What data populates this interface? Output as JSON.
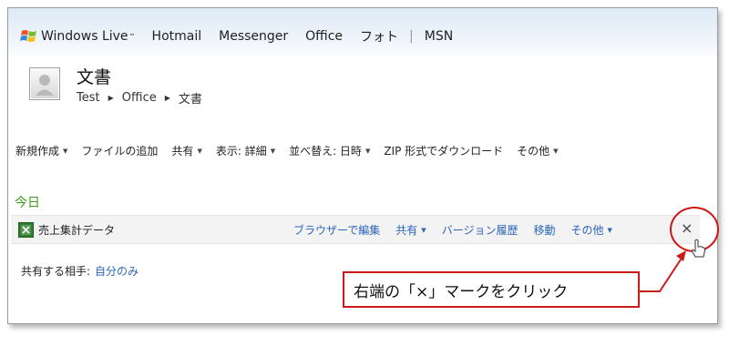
{
  "nav": {
    "brand": "Windows Live",
    "brand_tm": "™",
    "links": [
      "Hotmail",
      "Messenger",
      "Office",
      "フォト"
    ],
    "separator": "|",
    "last_link": "MSN"
  },
  "folder": {
    "title": "文書",
    "breadcrumb": [
      "Test",
      "Office",
      "文書"
    ]
  },
  "toolbar": {
    "items": [
      {
        "label": "新規作成",
        "dropdown": true
      },
      {
        "label": "ファイルの追加",
        "dropdown": false
      },
      {
        "label": "共有",
        "dropdown": true
      },
      {
        "label": "表示: 詳細",
        "dropdown": true
      },
      {
        "label": "並べ替え: 日時",
        "dropdown": true
      },
      {
        "label": "ZIP 形式でダウンロード",
        "dropdown": false
      },
      {
        "label": "その他",
        "dropdown": true
      }
    ]
  },
  "section_label": "今日",
  "file": {
    "icon": "excel-file-icon",
    "name": "売上集計データ",
    "actions": [
      {
        "label": "ブラウザーで編集",
        "dropdown": false
      },
      {
        "label": "共有",
        "dropdown": true
      },
      {
        "label": "バージョン履歴",
        "dropdown": false
      },
      {
        "label": "移動",
        "dropdown": false
      },
      {
        "label": "その他",
        "dropdown": true
      }
    ],
    "delete_glyph": "×"
  },
  "sharing": {
    "label": "共有する相手:",
    "value": "自分のみ"
  },
  "annotation": {
    "text": "右端の「×」マークをクリック",
    "color": "#cc1a1a"
  },
  "colors": {
    "link": "#2a66b8",
    "section": "#3d9a1f"
  }
}
